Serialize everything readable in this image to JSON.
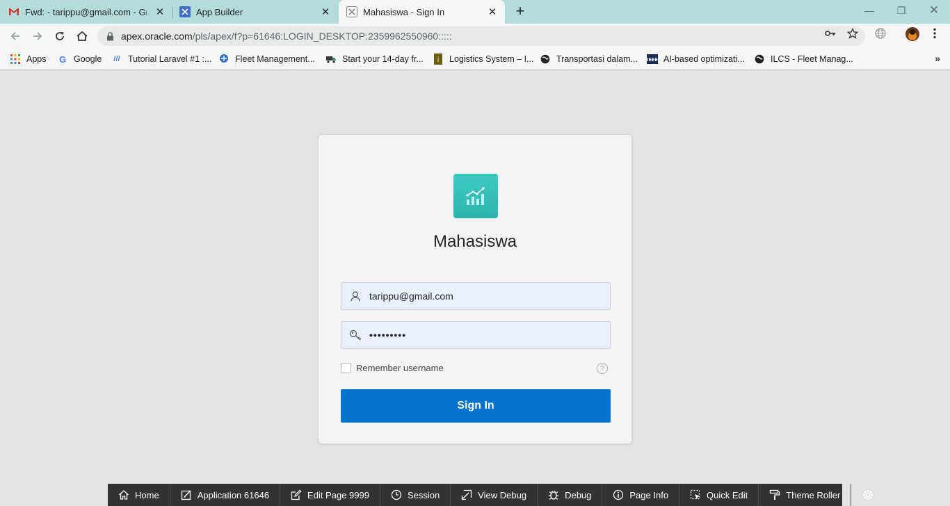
{
  "browser": {
    "tabs": [
      {
        "title": "Fwd: - tarippu@gmail.com - Gma",
        "icon": "gmail-icon"
      },
      {
        "title": "App Builder",
        "icon": "app-builder-icon"
      },
      {
        "title": "Mahasiswa - Sign In",
        "icon": "apex-icon",
        "active": true
      }
    ],
    "url_host": "apex.oracle.com",
    "url_path": "/pls/apex/f?p=61646:LOGIN_DESKTOP:2359962550960:::::",
    "bookmarks": [
      {
        "label": "Apps",
        "icon": "apps-grid-icon"
      },
      {
        "label": "Google",
        "icon": "google-icon"
      },
      {
        "label": "Tutorial Laravel #1 :...",
        "icon": "laravel-icon"
      },
      {
        "label": "Fleet Management...",
        "icon": "fleet-icon"
      },
      {
        "label": "Start your 14-day fr...",
        "icon": "truck-icon"
      },
      {
        "label": "Logistics System – I...",
        "icon": "logistics-icon"
      },
      {
        "label": "Transportasi dalam...",
        "icon": "globe-icon"
      },
      {
        "label": "AI-based optimizati...",
        "icon": "ieee-icon"
      },
      {
        "label": "ILCS - Fleet Manag...",
        "icon": "globe-icon"
      }
    ]
  },
  "login": {
    "app_title": "Mahasiswa",
    "username_value": "tarippu@gmail.com",
    "password_value": "•••••••••",
    "remember_label": "Remember username",
    "signin_label": "Sign In",
    "accent_color": "#0572ce",
    "icon_color": "#35bfb8"
  },
  "devbar": {
    "items": [
      {
        "label": "Home",
        "icon": "home-icon"
      },
      {
        "label": "Application 61646",
        "icon": "edit-icon"
      },
      {
        "label": "Edit Page 9999",
        "icon": "edit-page-icon"
      },
      {
        "label": "Session",
        "icon": "clock-icon"
      },
      {
        "label": "View Debug",
        "icon": "view-debug-icon"
      },
      {
        "label": "Debug",
        "icon": "bug-icon"
      },
      {
        "label": "Page Info",
        "icon": "info-icon"
      },
      {
        "label": "Quick Edit",
        "icon": "quick-edit-icon"
      },
      {
        "label": "Theme Roller",
        "icon": "paint-roller-icon"
      }
    ]
  }
}
